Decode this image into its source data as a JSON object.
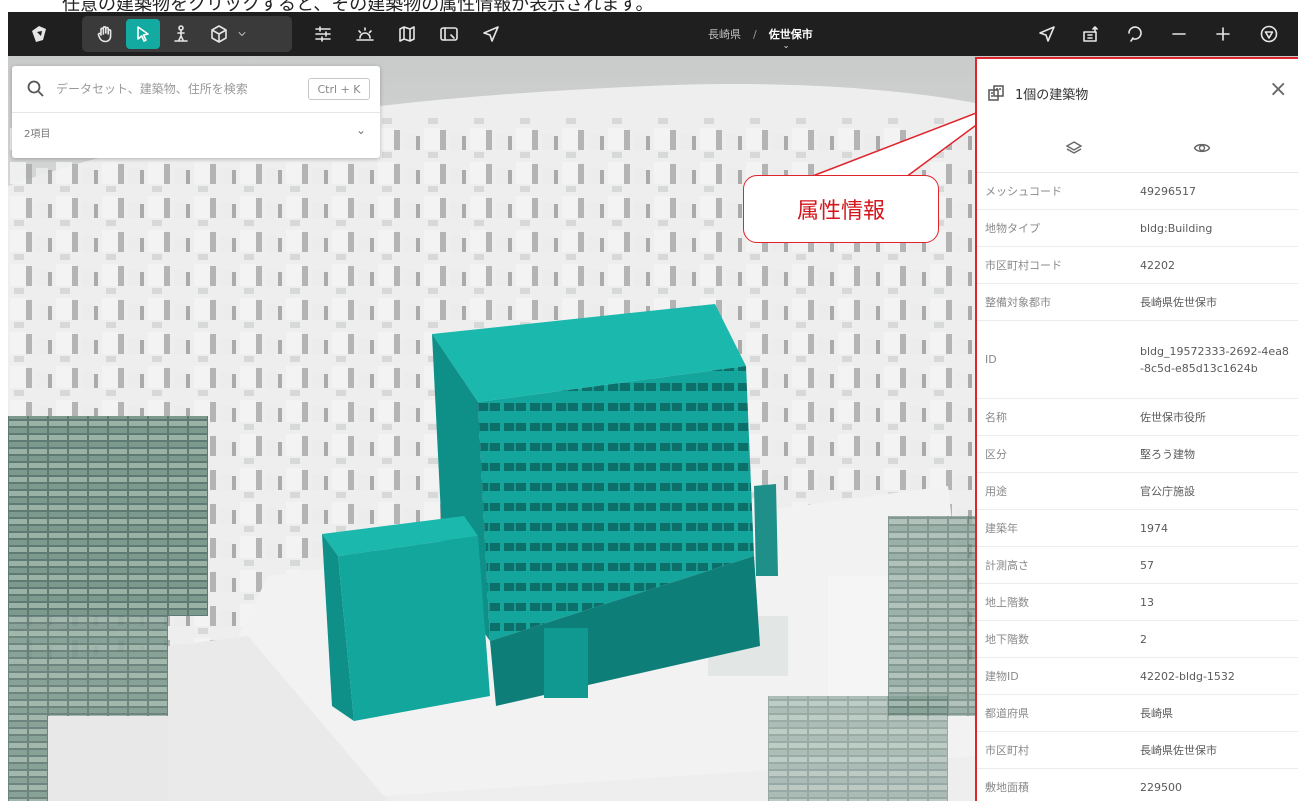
{
  "caption": "任意の建築物をクリックすると、その建築物の属性情報が表示されます。",
  "toolbar": {
    "tools": [
      {
        "icon": "logo-icon"
      },
      {
        "icon": "hand-icon"
      },
      {
        "icon": "pointer-icon",
        "active": true
      },
      {
        "icon": "pedestrian-icon"
      },
      {
        "icon": "box-icon"
      },
      {
        "icon": "sliders-icon"
      },
      {
        "icon": "sun-icon"
      },
      {
        "icon": "map-icon"
      },
      {
        "icon": "screen-icon"
      },
      {
        "icon": "send-icon"
      }
    ],
    "breadcrumb": {
      "prefecture": "長崎県",
      "separator": "/",
      "city": "佐世保市"
    },
    "right_tools": [
      "navigate-icon",
      "share-icon",
      "undo-icon",
      "zoom-out-icon",
      "zoom-in-icon",
      "compass-icon"
    ],
    "accent_color": "#13aaa1"
  },
  "search": {
    "placeholder": "データセット、建築物、住所を検索",
    "shortcut": "Ctrl + K",
    "items_label": "2項目"
  },
  "callout": {
    "text": "属性情報"
  },
  "panel": {
    "title": "1個の建築物",
    "attributes": [
      {
        "key": "メッシュコード",
        "value": "49296517"
      },
      {
        "key": "地物タイプ",
        "value": "bldg:Building"
      },
      {
        "key": "市区町村コード",
        "value": "42202"
      },
      {
        "key": "整備対象都市",
        "value": "長崎県佐世保市"
      },
      {
        "key": "ID",
        "value": "bldg_19572333-2692-4ea8-8c5d-e85d13c1624b"
      },
      {
        "key": "名称",
        "value": "佐世保市役所"
      },
      {
        "key": "区分",
        "value": "堅ろう建物"
      },
      {
        "key": "用途",
        "value": "官公庁施設"
      },
      {
        "key": "建築年",
        "value": "1974"
      },
      {
        "key": "計測高さ",
        "value": "57"
      },
      {
        "key": "地上階数",
        "value": "13"
      },
      {
        "key": "地下階数",
        "value": "2"
      },
      {
        "key": "建物ID",
        "value": "42202-bldg-1532"
      },
      {
        "key": "都道府県",
        "value": "長崎県"
      },
      {
        "key": "市区町村",
        "value": "長崎県佐世保市"
      },
      {
        "key": "敷地面積",
        "value": "229500"
      }
    ]
  },
  "colors": {
    "highlight_building": "#12a39b",
    "panel_border": "#e0242b"
  }
}
